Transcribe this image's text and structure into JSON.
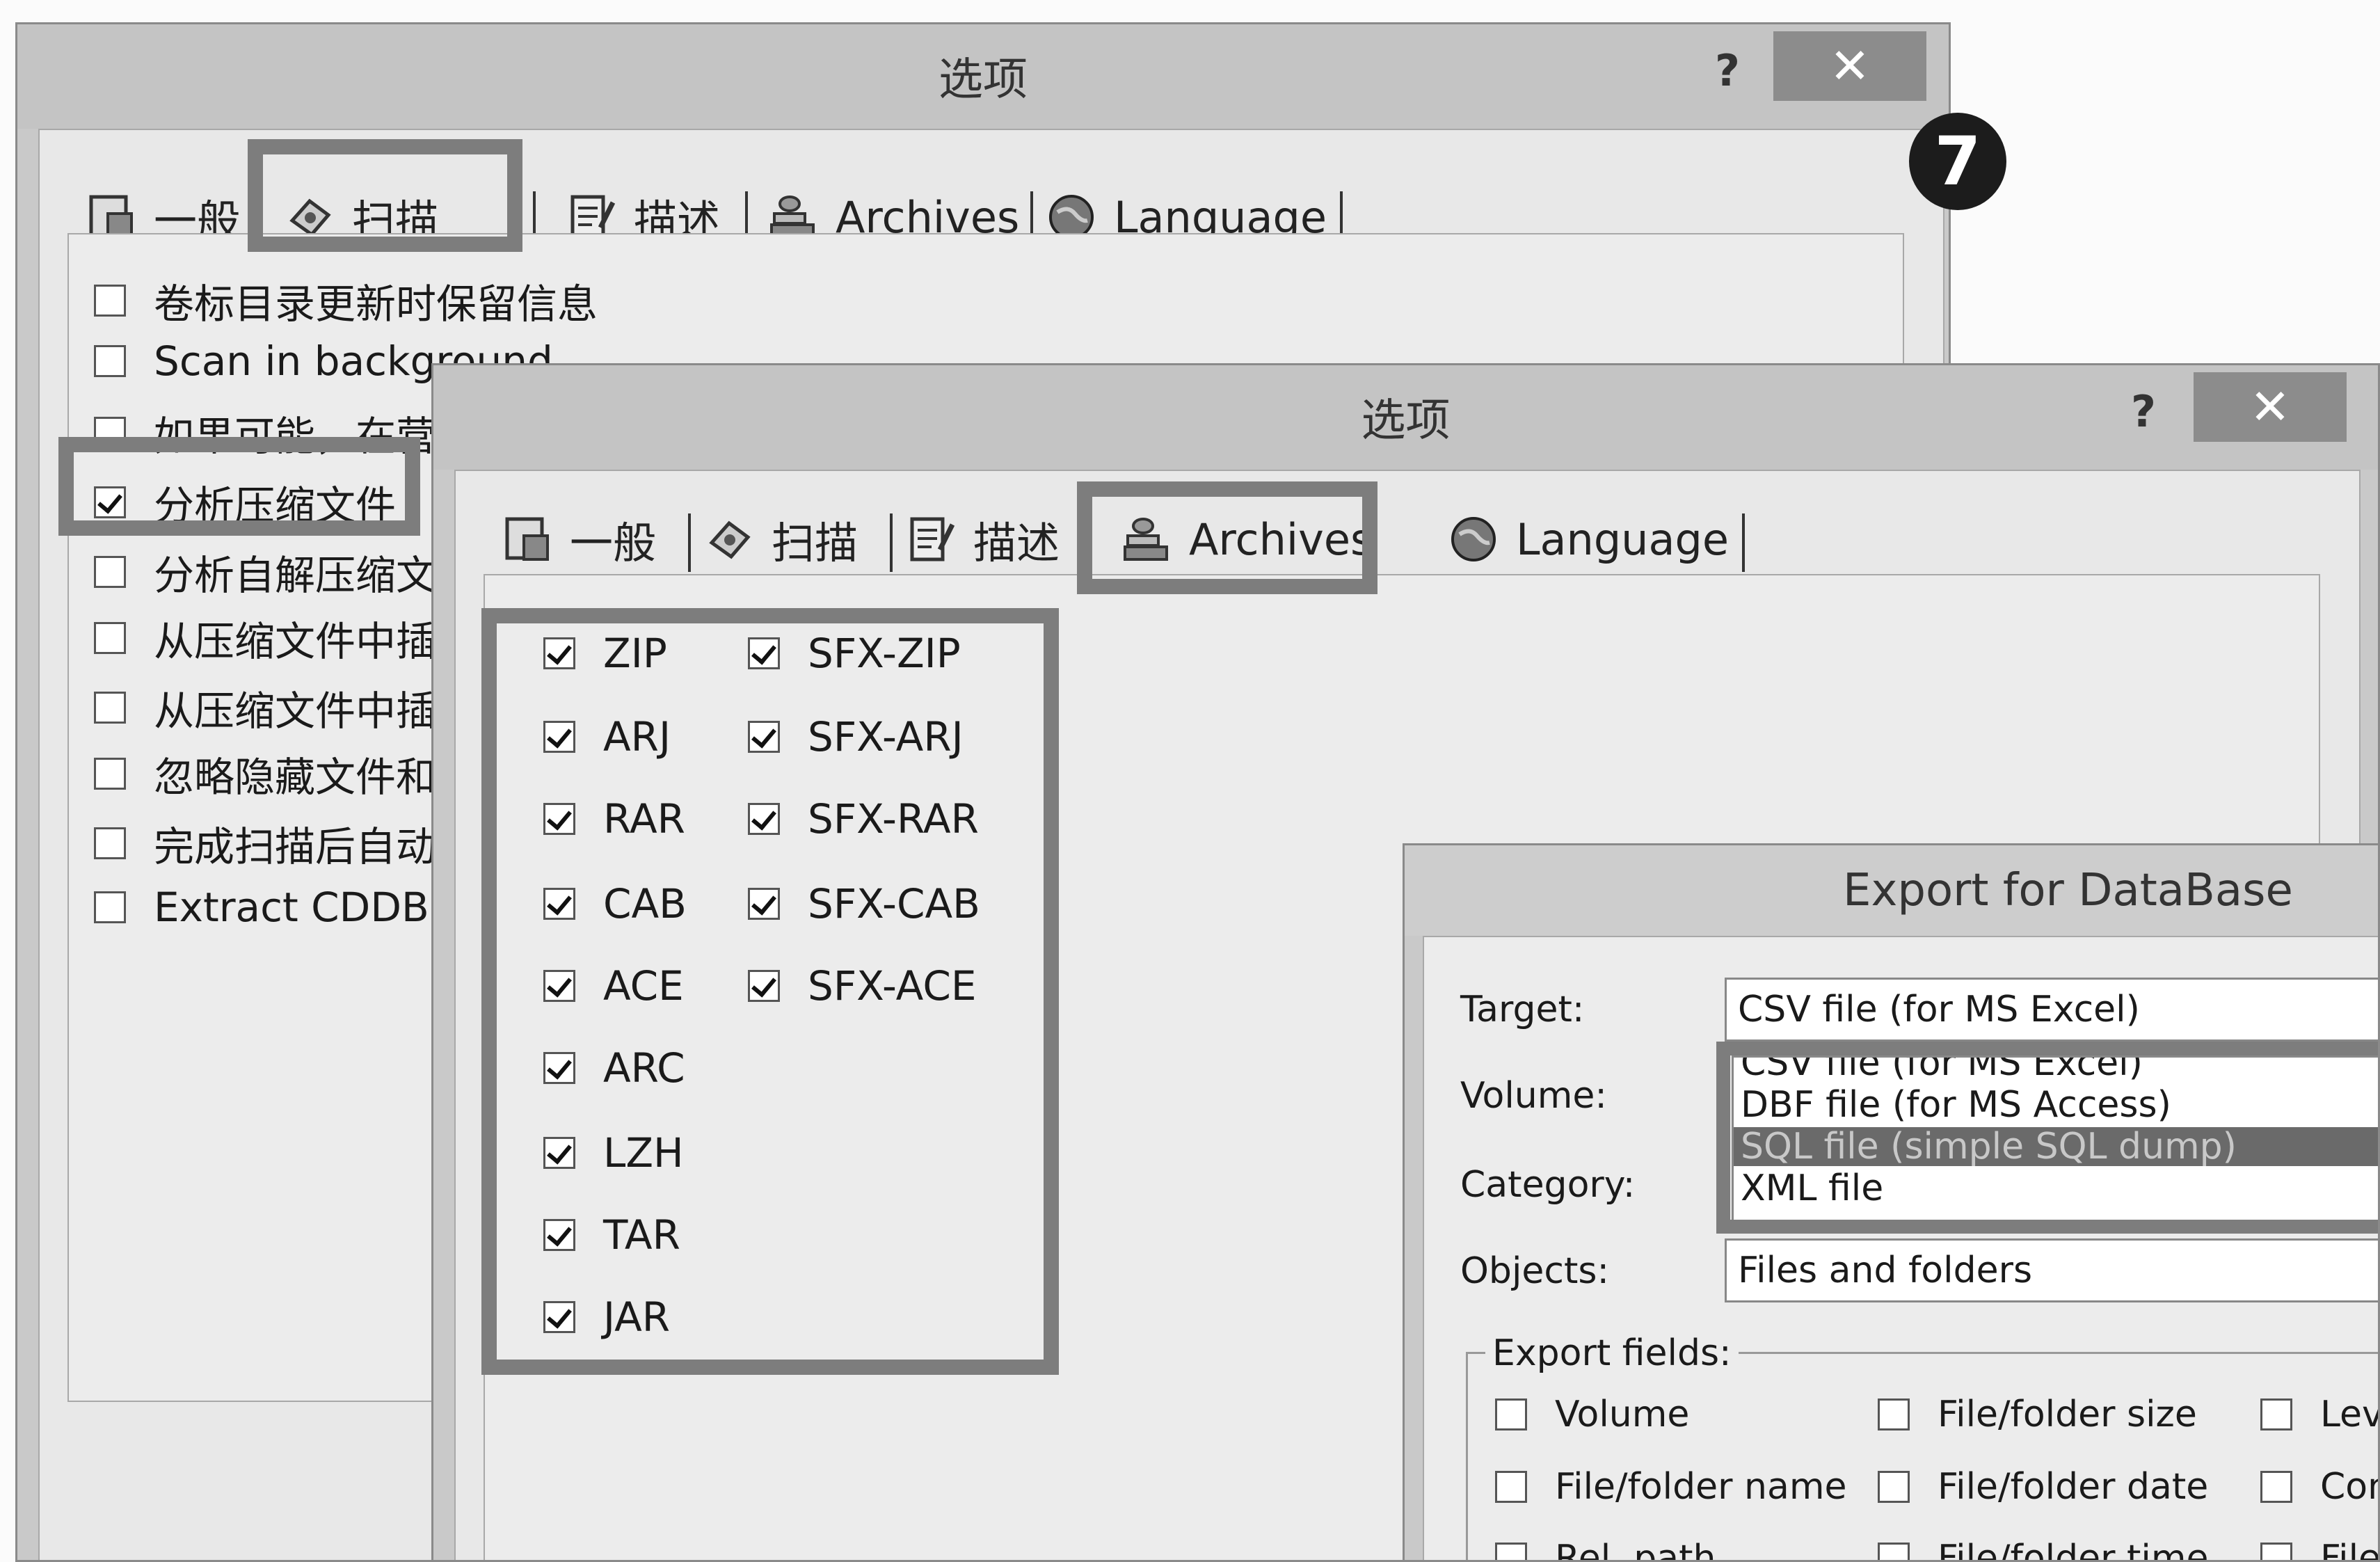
{
  "step_badge": "7",
  "options_dialog_1": {
    "title": "选项",
    "help": "?",
    "close": "✕",
    "tabs": [
      "一般",
      "扫描",
      "描述",
      "Archives",
      "Language"
    ],
    "items": [
      {
        "label": "卷标目录更新时保留信息",
        "checked": false
      },
      {
        "label": "Scan in background",
        "checked": false
      },
      {
        "label": "如果可能，在营",
        "checked": false
      },
      {
        "label": "分析压缩文件",
        "checked": true
      },
      {
        "label": "分析自解压缩文",
        "checked": false
      },
      {
        "label": "从压缩文件中插",
        "checked": false
      },
      {
        "label": "从压缩文件中插",
        "checked": false
      },
      {
        "label": "忽略隐藏文件和",
        "checked": false
      },
      {
        "label": "完成扫描后自动",
        "checked": false
      },
      {
        "label": "Extract CDDB (fre",
        "checked": false
      }
    ]
  },
  "options_dialog_2": {
    "title": "选项",
    "help": "?",
    "close": "✕",
    "tabs": [
      "一般",
      "扫描",
      "描述",
      "Archives",
      "Language"
    ],
    "archives_left": [
      "ZIP",
      "ARJ",
      "RAR",
      "CAB",
      "ACE",
      "ARC",
      "LZH",
      "TAR",
      "JAR"
    ],
    "archives_right": [
      "SFX-ZIP",
      "SFX-ARJ",
      "SFX-RAR",
      "SFX-CAB",
      "SFX-ACE"
    ]
  },
  "export_dialog": {
    "title": "Export for DataBase",
    "target_label": "Target:",
    "target_value": "CSV file (for MS Excel)",
    "volume_label": "Volume:",
    "category_label": "Category:",
    "objects_label": "Objects:",
    "objects_value": "Files and folders",
    "dropdown_options": [
      "CSV file (for MS Excel)",
      "DBF file (for MS Access)",
      "SQL file (simple SQL dump)",
      "XML file"
    ],
    "dropdown_selected_index": 2,
    "export_fields_label": "Export fields:",
    "fields": [
      [
        "Volume",
        "File/folder size",
        "Leve"
      ],
      [
        "File/folder name",
        "File/folder date",
        "Com"
      ],
      [
        "Rel. path",
        "File/folder time",
        "File"
      ]
    ]
  }
}
